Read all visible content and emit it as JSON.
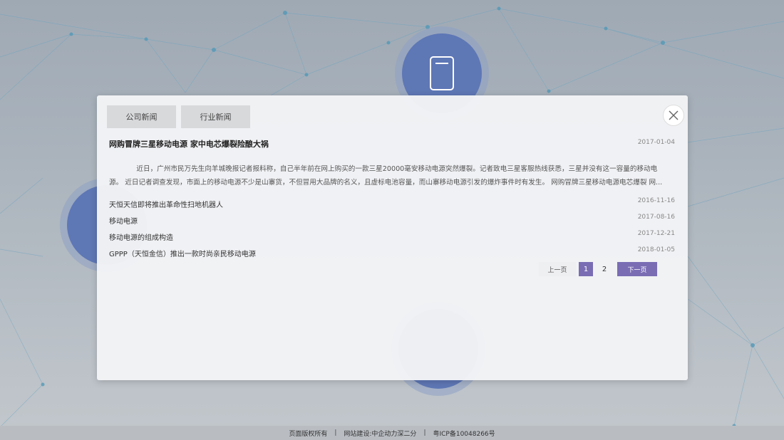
{
  "tabs": [
    {
      "label": "公司新闻"
    },
    {
      "label": "行业新闻"
    }
  ],
  "featured": {
    "title": "网购冒牌三星移动电源 家中电芯爆裂险酿大祸",
    "date": "2017-01-04",
    "summary": "近日，广州市民万先生向羊城晚报记者报料称，自己半年前在网上购买的一款三星20000毫安移动电源突然爆裂。记者致电三星客服热线获悉，三星并没有这一容量的移动电源。 近日记者调查发现，市面上的移动电源不少是山寨货，不但冒用大品牌的名义，且虚标电池容量，而山寨移动电源引发的爆炸事件时有发生。 网购冒牌三星移动电源电芯爆裂 网..."
  },
  "news": [
    {
      "title": "天恒天信即将推出革命性扫地机器人",
      "date": "2016-11-16"
    },
    {
      "title": "移动电源",
      "date": "2017-08-16"
    },
    {
      "title": "移动电源的组成构造",
      "date": "2017-12-21"
    },
    {
      "title": "GPPP（天恒金信）推出一款时尚亲民移动电源",
      "date": "2018-01-05"
    }
  ],
  "pagination": {
    "prev": "上一页",
    "pages": [
      "1",
      "2"
    ],
    "current": "1",
    "next": "下一页"
  },
  "footer": {
    "copyright": "页面版权所有",
    "builder": "网站建设:中企动力深二分",
    "icp": "粤ICP备10048266号",
    "separator": "|"
  },
  "colors": {
    "accent": "#7a6db4",
    "circle": "#5b74b4"
  },
  "icons": [
    "close-icon",
    "power-bank-icon",
    "robot-icon",
    "flashlight-icon"
  ]
}
